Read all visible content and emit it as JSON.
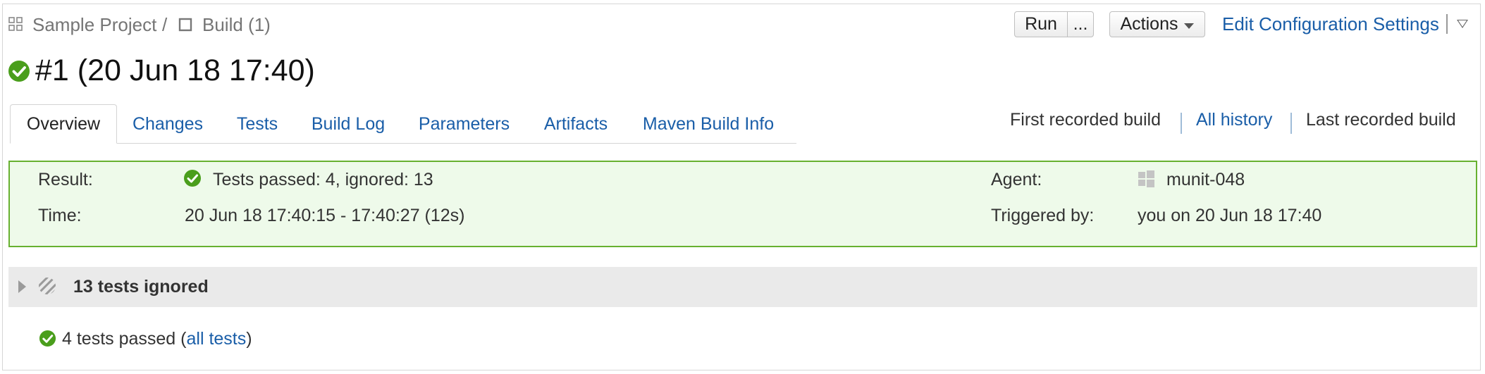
{
  "breadcrumb": {
    "project": "Sample Project",
    "separator": "/",
    "build": "Build (1)"
  },
  "header": {
    "run_label": "Run",
    "more_label": "...",
    "actions_label": "Actions",
    "edit_settings_label": "Edit Configuration Settings"
  },
  "build": {
    "title": "#1 (20 Jun 18 17:40)",
    "status": "success"
  },
  "tabs": [
    {
      "label": "Overview",
      "active": true
    },
    {
      "label": "Changes"
    },
    {
      "label": "Tests"
    },
    {
      "label": "Build Log"
    },
    {
      "label": "Parameters"
    },
    {
      "label": "Artifacts"
    },
    {
      "label": "Maven Build Info"
    }
  ],
  "history": {
    "first": "First recorded build",
    "all": "All history",
    "last": "Last recorded build"
  },
  "summary": {
    "result_label": "Result:",
    "result_value": "Tests passed: 4, ignored: 13",
    "time_label": "Time:",
    "time_value": "20 Jun 18 17:40:15 - 17:40:27 (12s)",
    "agent_label": "Agent:",
    "agent_value": "munit-048",
    "triggered_label": "Triggered by:",
    "triggered_value": "you on 20 Jun 18 17:40"
  },
  "ignored": {
    "label": "13 tests ignored"
  },
  "passed": {
    "prefix": "4 tests passed (",
    "link": "all tests",
    "suffix": ")"
  },
  "colors": {
    "success": "#4a9e1c",
    "link": "#1a5ea8",
    "result_border": "#67b130",
    "result_bg": "#eefaea"
  },
  "icons": {
    "breadcrumb": "grid-icon",
    "build_config": "square-icon",
    "status": "check-circle-icon",
    "agent": "windows-icon",
    "ignored": "striped-circle-icon"
  }
}
